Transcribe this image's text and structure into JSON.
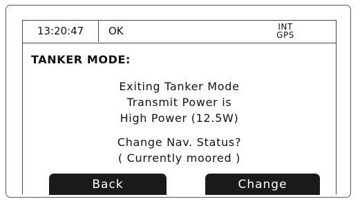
{
  "status_bar": {
    "time": "13:20:47",
    "message": "OK",
    "source_line_1": "INT",
    "source_line_2": "GPS"
  },
  "screen": {
    "title": "TANKER MODE:",
    "message_lines": [
      "Exiting Tanker Mode",
      "Transmit Power is",
      "High Power (12.5W)"
    ],
    "question_lines": [
      "Change Nav. Status?",
      "( Currently moored )"
    ]
  },
  "softkeys": {
    "left_label": "Back",
    "right_label": "Change"
  }
}
